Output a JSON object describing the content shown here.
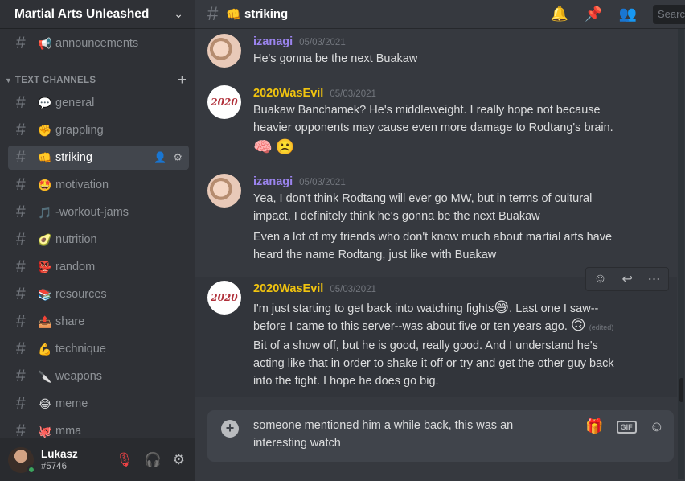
{
  "server": {
    "name": "Martial Arts Unleashed"
  },
  "sidebar": {
    "top_channel": {
      "emoji": "📢",
      "label": "announcements"
    },
    "category_label": "TEXT CHANNELS",
    "channels": [
      {
        "emoji": "💬",
        "label": "general"
      },
      {
        "emoji": "✊",
        "label": "grappling"
      },
      {
        "emoji": "👊",
        "label": "striking"
      },
      {
        "emoji": "🤩",
        "label": "motivation"
      },
      {
        "emoji": "🎵",
        "label": "-workout-jams"
      },
      {
        "emoji": "🥑",
        "label": "nutrition"
      },
      {
        "emoji": "👺",
        "label": "random"
      },
      {
        "emoji": "📚",
        "label": "resources"
      },
      {
        "emoji": "📤",
        "label": "share"
      },
      {
        "emoji": "💪",
        "label": "technique"
      },
      {
        "emoji": "🔪",
        "label": "weapons"
      },
      {
        "emoji": "😂",
        "label": "meme"
      },
      {
        "emoji": "🐙",
        "label": "mma"
      }
    ],
    "active_index": 2
  },
  "user": {
    "name": "Lukasz",
    "tag": "#5746"
  },
  "channel_header": {
    "emoji": "👊",
    "name": "striking",
    "search_placeholder": "Search"
  },
  "messages": [
    {
      "author": "izanagi",
      "author_color": "#9b84ee",
      "time": "05/03/2021",
      "lines": [
        "He's gonna be the next Buakaw"
      ]
    },
    {
      "author": "2020WasEvil",
      "author_color": "#f1c40f",
      "time": "05/03/2021",
      "lines": [
        "Buakaw Banchamek? He's middleweight. I really hope not because",
        "heavier opponents may cause even more damage to Rodtang's brain."
      ],
      "reactions": [
        "🧠",
        "☹️"
      ]
    },
    {
      "author": "izanagi",
      "author_color": "#9b84ee",
      "time": "05/03/2021",
      "lines": [
        "Yea, I don't think Rodtang will ever go MW, but in terms of cultural",
        "impact, I definitely think he's gonna be the next Buakaw",
        "Even a lot of my friends who don't know much about martial arts have",
        "heard the name Rodtang, just like with Buakaw"
      ]
    },
    {
      "author": "2020WasEvil",
      "author_color": "#f1c40f",
      "time": "05/03/2021",
      "line1a": "I'm just starting to get back into watching fights",
      "emoji1": "😅",
      "line1b": ". Last one I saw--",
      "line2a": "before I came to this server--was about five or ten years ago. ",
      "emoji2": "🙃",
      "edited": "(edited)",
      "lines": [
        "Bit of a show off, but he is good, really good. And I understand he's",
        "acting like that in order to shake it off or try and get the other guy back",
        "into the fight. I hope he does go big."
      ]
    }
  ],
  "composer": {
    "line1": "someone mentioned him a while back, this was an",
    "line2": "interesting watch",
    "gif_label": "GIF"
  }
}
